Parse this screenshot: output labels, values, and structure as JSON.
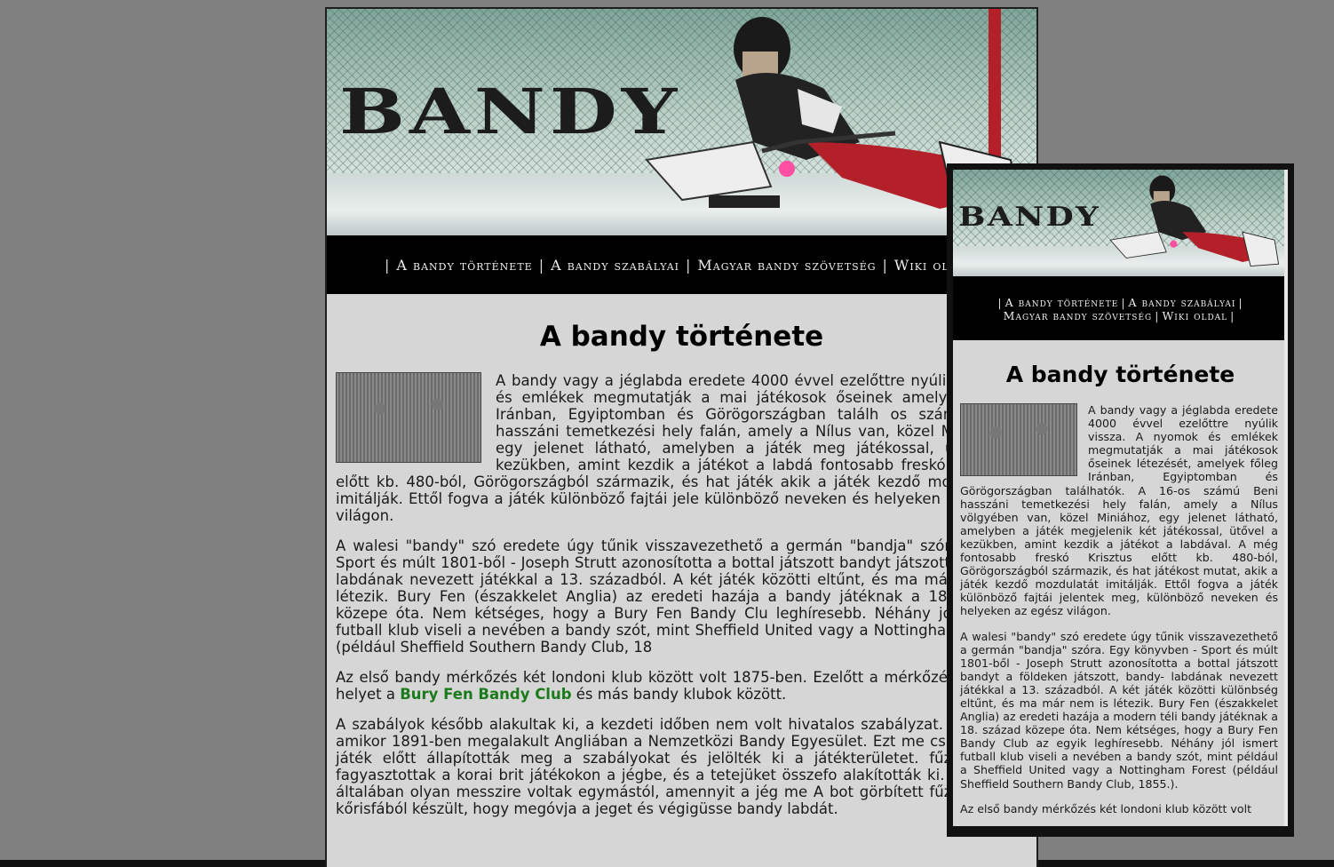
{
  "site": {
    "banner_title": "BANDY",
    "nav": [
      {
        "label": "A bandy története"
      },
      {
        "label": "A bandy szabályai"
      },
      {
        "label": "Magyar bandy szövetség"
      },
      {
        "label": "Wiki oldal"
      }
    ],
    "nav_truncated": "Wiki ol",
    "heading": "A bandy története",
    "paragraphs_large": {
      "p1": "A bandy vagy a jéglabda eredete 4000 évvel ezelőttre nyúli nyomok és emlékek megmutatják a mai játékosok őseinek amelyek főleg Iránban, Egyiptomban és Görögországban találh os számú Beni hasszáni temetkezési hely falán, amely a Nílus van, közel Miniához, egy jelenet látható, amelyben a játék meg játékossal, ütővel a kezükben, amint kezdik a játékot a labdá fontosabb freskó Krisztus előtt kb. 480-ból, Görögországból származik, és hat játék akik a játék kezdő mozdulatát imitálják. Ettől fogva a játék különböző fajtái jele különböző neveken és helyeken az egész világon.",
      "p2": "A walesi \"bandy\" szó eredete úgy tűnik visszavezethető a germán \"bandja\" szóra. Egy - Sport és múlt 1801-ből - Joseph Strutt azonosította a bottal játszott bandyt játszott, bandy- labdának nevezett játékkal a 13. századból. A két játék közötti eltűnt, és ma már nem is létezik. Bury Fen (északkelet Anglia) az eredeti hazája a bandy játéknak a 18. század közepe óta. Nem kétséges, hogy a Bury Fen Bandy Clu leghíresebb. Néhány jól ismert futball klub viseli a nevében a bandy szót, mint Sheffield United vagy a Nottingham Forest (például Sheffield Southern Bandy Club, 18",
      "p3_before": "Az első bandy mérkőzés két londoni klub között volt 1875-ben. Ezelőtt a mérkőzés kaptak helyet a ",
      "p3_link": "Bury Fen Bandy Club",
      "p3_after": " és más bandy klubok között.",
      "p4": "A szabályok később alakultak ki, a kezdeti időben nem volt hivatalos szabályzat. Ez létre, amikor 1891-ben megalakult Angliában a Nemzetközi Bandy Egyesület. Ezt me csapatok a játék előtt állapították meg a szabályokat és jelölték ki a játékterületet. fűzfapálcát fagyasztottak a korai brit játékokon a jégbe, és a tetejüket összefo alakították ki. A kapuk általában olyan messzire voltak egymástól, amennyit a jég me A bot görbített fűzfából és kőrisfából készült, hogy megóvja a jeget és végigüsse bandy labdát."
    },
    "paragraphs_small": {
      "p1": "A bandy vagy a jéglabda eredete 4000 évvel ezelőttre nyúlik vissza. A nyomok és emlékek megmutatják a mai játékosok őseinek létezését, amelyek főleg Iránban, Egyiptomban és Görögországban találhatók. A 16-os számú Beni hasszáni temetkezési hely falán, amely a Nílus völgyében van, közel Miniához, egy jelenet látható, amelyben a játék megjelenik két játékossal, ütővel a kezükben, amint kezdik a játékot a labdával. A még fontosabb freskó Krisztus előtt kb. 480-ból, Görögországból származik, és hat játékost mutat, akik a játék kezdő mozdulatát imitálják. Ettől fogva a játék különböző fajtái jelentek meg, különböző neveken és helyeken az egész világon.",
      "p2": "A walesi \"bandy\" szó eredete úgy tűnik visszavezethető a germán \"bandja\" szóra. Egy könyvben - Sport és múlt 1801-ből - Joseph Strutt azonosította a bottal játszott bandyt a földeken játszott, bandy- labdának nevezett játékkal a 13. századból. A két játék közötti különbség eltűnt, és ma már nem is létezik. Bury Fen (északkelet Anglia) az eredeti hazája a modern téli bandy játéknak a 18. század közepe óta. Nem kétséges, hogy a Bury Fen Bandy Club az egyik leghíresebb. Néhány jól ismert futball klub viseli a nevében a bandy szót, mint például a Sheffield United vagy a Nottingham Forest (például Sheffield Southern Bandy Club, 1855.).",
      "p3": "Az első bandy mérkőzés két londoni klub között volt"
    },
    "colors": {
      "background": "#808080",
      "page": "#d6d6d6",
      "nav_bg": "#000000",
      "link_green": "#1b7a1b",
      "goal_red": "#b3202a"
    }
  }
}
